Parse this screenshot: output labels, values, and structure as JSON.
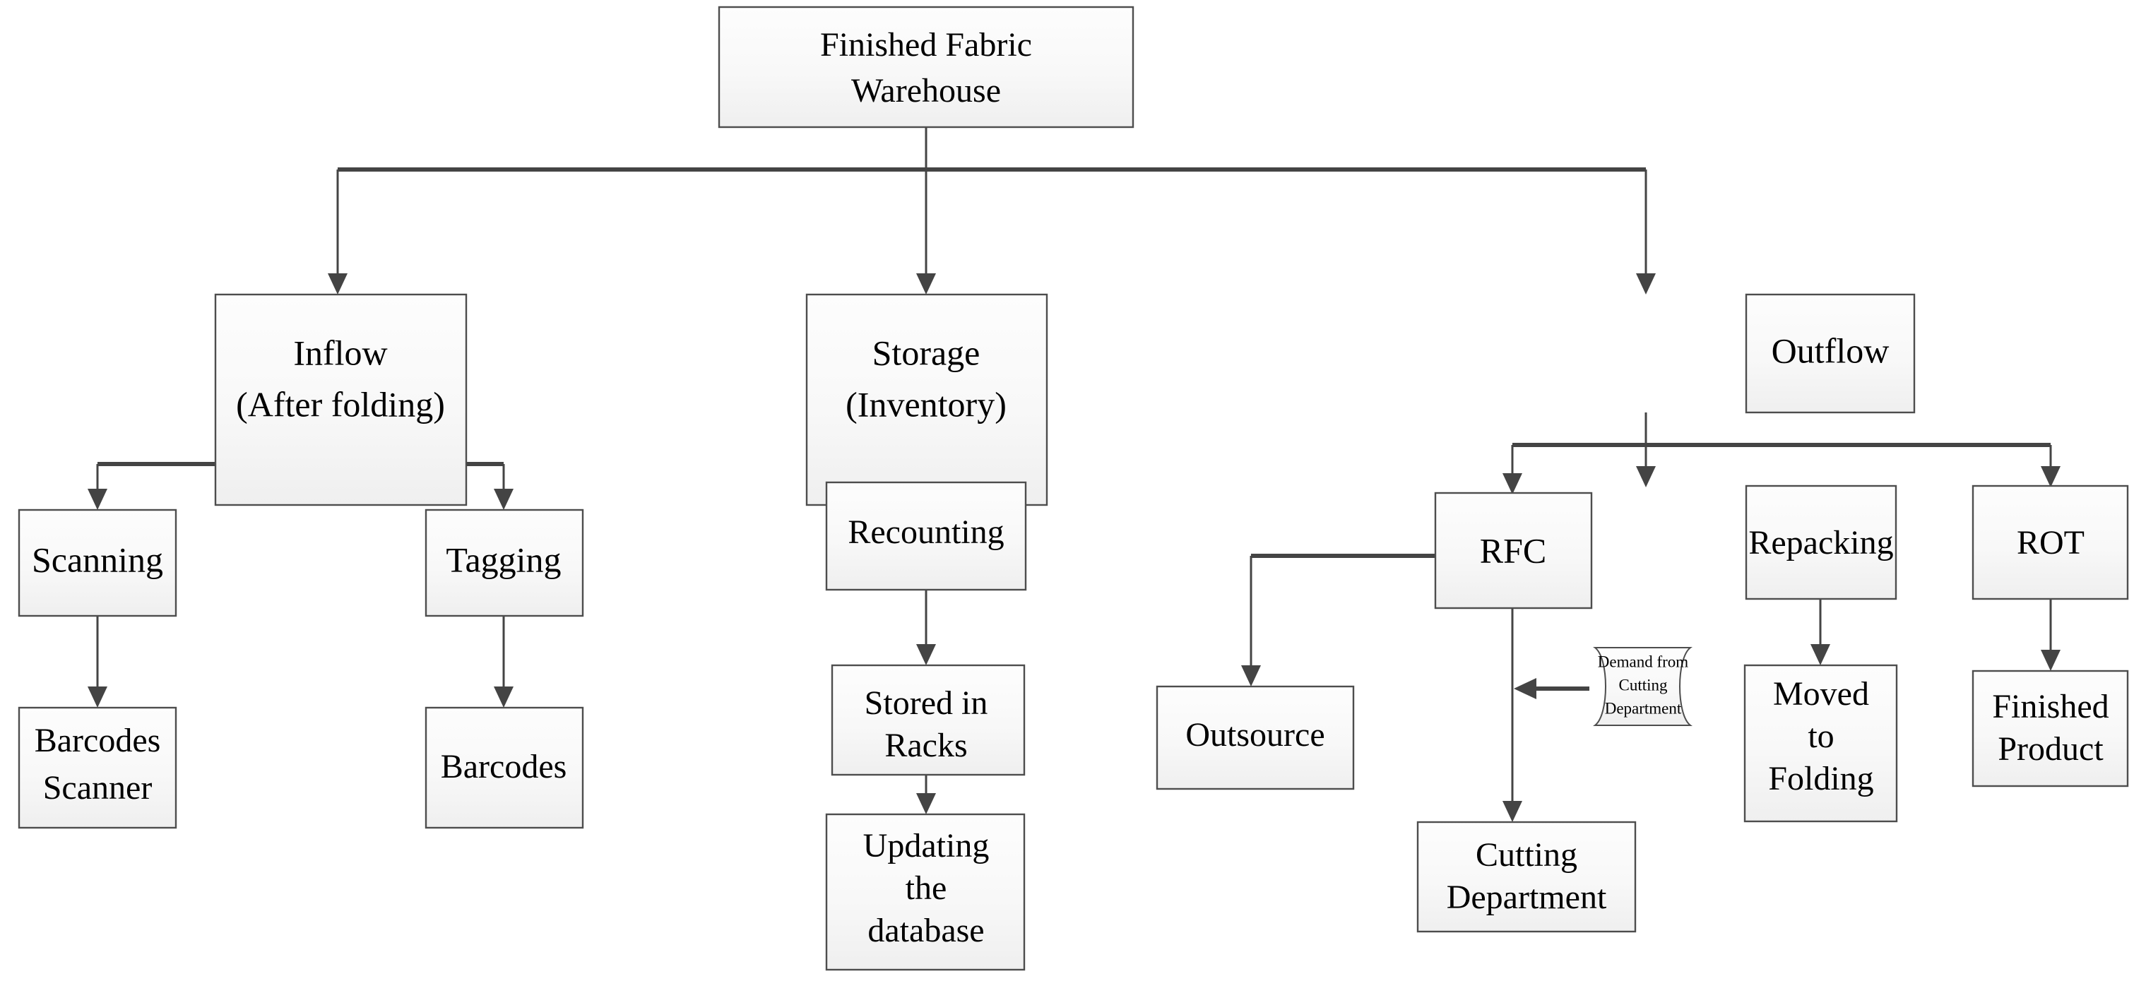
{
  "diagram": {
    "title": "Finished Fabric Warehouse process flowchart",
    "background_color": "#ffffff",
    "box_fill_top": "#fdfdfd",
    "box_fill_bottom": "#efefef",
    "box_border_color": "#4d4d4d",
    "connector_color": "#444444",
    "text_color": "#000000",
    "nodes": {
      "root": {
        "label": "Finished Fabric Warehouse",
        "line1": "Finished Fabric",
        "line2": "Warehouse"
      },
      "inflow": {
        "label": "Inflow (After folding)",
        "line1": "Inflow",
        "line2": "(After folding)"
      },
      "storage": {
        "label": "Storage (Inventory)",
        "line1": "Storage",
        "line2": "(Inventory)"
      },
      "outflow": {
        "label": "Outflow",
        "line1": "Outflow"
      },
      "scanning": {
        "label": "Scanning",
        "line1": "Scanning"
      },
      "tagging": {
        "label": "Tagging",
        "line1": "Tagging"
      },
      "barcodes_scanner": {
        "label": "Barcodes Scanner",
        "line1": "Barcodes",
        "line2": "Scanner"
      },
      "barcodes": {
        "label": "Barcodes",
        "line1": "Barcodes"
      },
      "recounting": {
        "label": "Recounting",
        "line1": "Recounting"
      },
      "stored_in_racks": {
        "label": "Stored in Racks",
        "line1": "Stored in",
        "line2": "Racks"
      },
      "updating_the_database": {
        "label": "Updating the database",
        "line1": "Updating",
        "line2": "the",
        "line3": "database"
      },
      "rfc": {
        "label": "RFC",
        "line1": "RFC"
      },
      "repacking": {
        "label": "Repacking",
        "line1": "Repacking"
      },
      "rot": {
        "label": "ROT",
        "line1": "ROT"
      },
      "outsource": {
        "label": "Outsource",
        "line1": "Outsource"
      },
      "cutting_department": {
        "label": "Cutting Department",
        "line1": "Cutting",
        "line2": "Department"
      },
      "moved_to_folding": {
        "label": "Moved to Folding",
        "line1": "Moved",
        "line2": "to",
        "line3": "Folding"
      },
      "finished_product": {
        "label": "Finished Product",
        "line1": "Finished",
        "line2": "Product"
      },
      "demand_note": {
        "label": "Demand from Cutting Department",
        "line1": "Demand from",
        "line2": "Cutting",
        "line3": "Department"
      }
    },
    "edges": [
      {
        "from": "root",
        "to": "inflow"
      },
      {
        "from": "root",
        "to": "storage"
      },
      {
        "from": "root",
        "to": "outflow"
      },
      {
        "from": "inflow",
        "to": "scanning"
      },
      {
        "from": "inflow",
        "to": "tagging"
      },
      {
        "from": "scanning",
        "to": "barcodes_scanner"
      },
      {
        "from": "tagging",
        "to": "barcodes"
      },
      {
        "from": "storage",
        "to": "recounting"
      },
      {
        "from": "recounting",
        "to": "stored_in_racks"
      },
      {
        "from": "stored_in_racks",
        "to": "updating_the_database"
      },
      {
        "from": "outflow",
        "to": "rfc"
      },
      {
        "from": "outflow",
        "to": "repacking"
      },
      {
        "from": "outflow",
        "to": "rot"
      },
      {
        "from": "rfc",
        "to": "outsource"
      },
      {
        "from": "rfc",
        "to": "cutting_department"
      },
      {
        "from": "demand_note",
        "to": "cutting_department"
      },
      {
        "from": "repacking",
        "to": "moved_to_folding"
      },
      {
        "from": "rot",
        "to": "finished_product"
      }
    ]
  }
}
